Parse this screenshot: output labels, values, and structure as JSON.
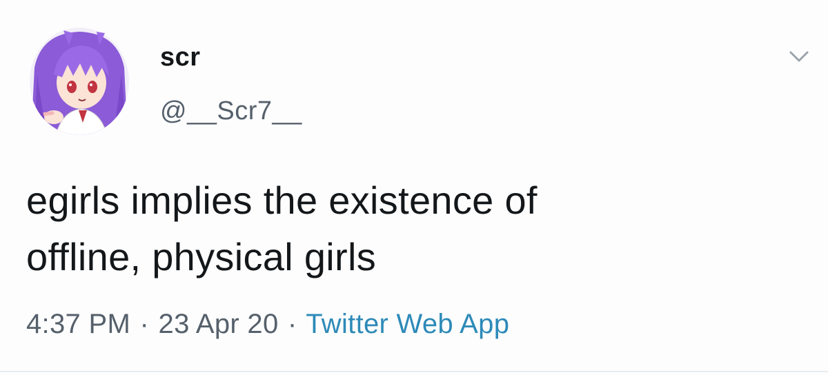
{
  "user": {
    "display_name": "scr",
    "handle": "@__Scr7__"
  },
  "tweet": {
    "text_line_1": "egirls implies the existence of",
    "text_line_2": "offline, physical girls"
  },
  "meta": {
    "time": "4:37 PM",
    "separator": "·",
    "date": "23 Apr 20",
    "source": "Twitter Web App"
  },
  "colors": {
    "text": "#14171a",
    "secondary": "#55606b",
    "link": "#2d8ab8",
    "avatar_hair": "#8b5bd8"
  },
  "icons": {
    "avatar": "anime-avatar",
    "menu": "chevron-down-icon"
  }
}
